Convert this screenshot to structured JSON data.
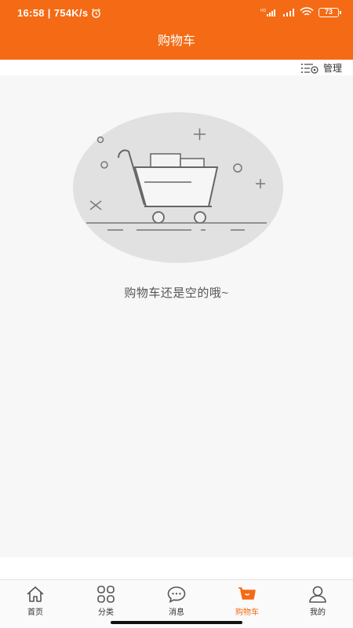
{
  "status": {
    "time": "16:58",
    "speed": "754K/s",
    "battery": "73"
  },
  "header": {
    "title": "购物车",
    "manage_label": "管理"
  },
  "empty": {
    "message": "购物车还是空的哦~"
  },
  "tabs": [
    {
      "label": "首页",
      "icon": "home-icon"
    },
    {
      "label": "分类",
      "icon": "grid-icon"
    },
    {
      "label": "消息",
      "icon": "chat-icon"
    },
    {
      "label": "购物车",
      "icon": "cart-icon",
      "active": true
    },
    {
      "label": "我的",
      "icon": "user-icon"
    }
  ],
  "colors": {
    "accent": "#f56a14",
    "background": "#f7f7f7"
  }
}
